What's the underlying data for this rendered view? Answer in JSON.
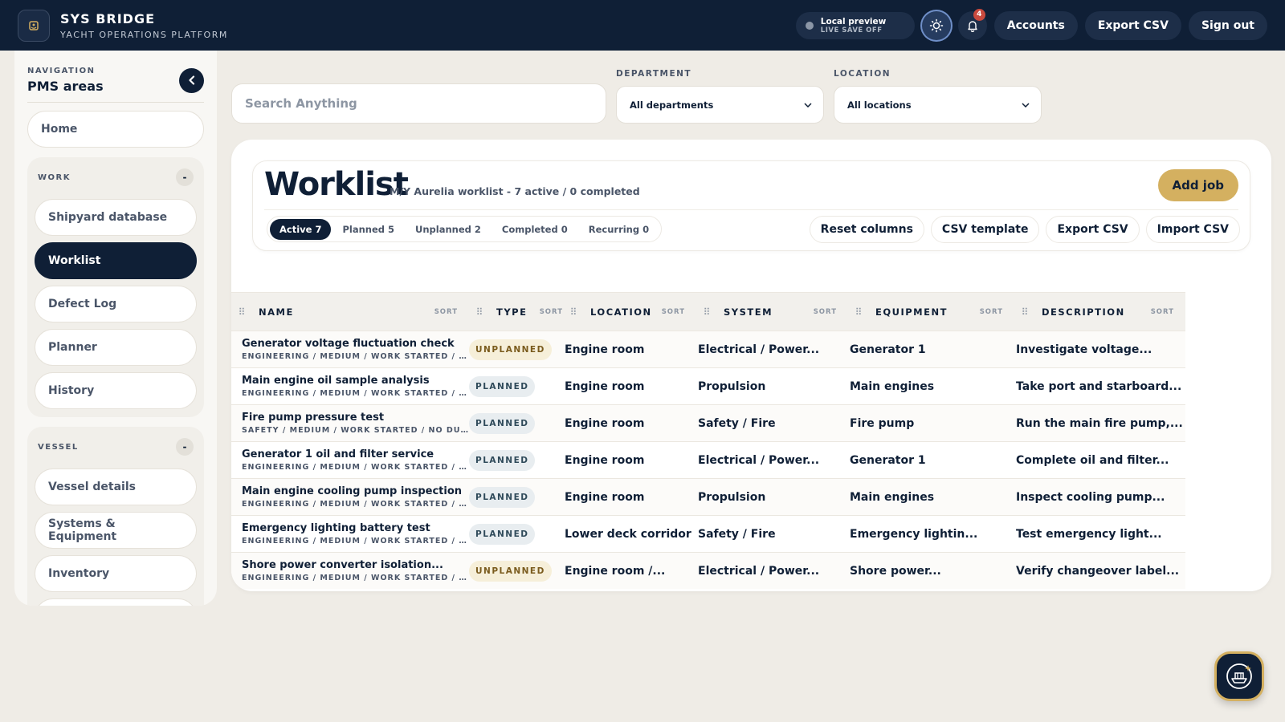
{
  "app": {
    "title": "SYS BRIDGE",
    "subtitle": "YACHT OPERATIONS PLATFORM"
  },
  "topbar": {
    "preview_title": "Local preview",
    "preview_sub": "LIVE SAVE OFF",
    "notifications_count": "4",
    "accounts_label": "Accounts",
    "export_label": "Export CSV",
    "signout_label": "Sign out"
  },
  "sidebar": {
    "kicker": "NAVIGATION",
    "title": "PMS areas",
    "home_label": "Home",
    "groups": [
      {
        "label": "WORK",
        "toggle": "-",
        "items": [
          "Shipyard database",
          "Worklist",
          "Defect Log",
          "Planner",
          "History"
        ]
      },
      {
        "label": "VESSEL",
        "toggle": "-",
        "items": [
          "Vessel details",
          "Systems & Equipment",
          "Inventory"
        ]
      }
    ],
    "active_item": "Worklist"
  },
  "filters": {
    "search_placeholder": "Search Anything",
    "department_label": "DEPARTMENT",
    "department_value": "All departments",
    "location_label": "LOCATION",
    "location_value": "All locations"
  },
  "worklist": {
    "title": "Worklist",
    "subtitle": "M/Y Aurelia worklist - 7 active / 0 completed",
    "add_label": "Add job",
    "tabs": [
      "Active 7",
      "Planned 5",
      "Unplanned 2",
      "Completed 0",
      "Recurring 0"
    ],
    "actions": [
      "Reset columns",
      "CSV template",
      "Export CSV",
      "Import CSV"
    ]
  },
  "table": {
    "sort_label": "SORT",
    "columns": [
      "NAME",
      "TYPE",
      "LOCATION",
      "SYSTEM",
      "EQUIPMENT",
      "DESCRIPTION"
    ],
    "rows": [
      {
        "name": "Generator voltage fluctuation check",
        "meta": "ENGINEERING / MEDIUM / WORK STARTED / ...",
        "type": "UNPLANNED",
        "location": "Engine room",
        "system": "Electrical / Power...",
        "equipment": "Generator 1",
        "description": "Investigate voltage..."
      },
      {
        "name": "Main engine oil sample analysis",
        "meta": "ENGINEERING / MEDIUM / WORK STARTED / ...",
        "type": "PLANNED",
        "location": "Engine room",
        "system": "Propulsion",
        "equipment": "Main engines",
        "description": "Take port and starboard..."
      },
      {
        "name": "Fire pump pressure test",
        "meta": "SAFETY / MEDIUM / WORK STARTED / NO DU...",
        "type": "PLANNED",
        "location": "Engine room",
        "system": "Safety / Fire",
        "equipment": "Fire pump",
        "description": "Run the main fire pump,..."
      },
      {
        "name": "Generator 1 oil and filter service",
        "meta": "ENGINEERING / MEDIUM / WORK STARTED / ...",
        "type": "PLANNED",
        "location": "Engine room",
        "system": "Electrical / Power...",
        "equipment": "Generator 1",
        "description": "Complete oil and filter..."
      },
      {
        "name": "Main engine cooling pump inspection",
        "meta": "ENGINEERING / MEDIUM / WORK STARTED / ...",
        "type": "PLANNED",
        "location": "Engine room",
        "system": "Propulsion",
        "equipment": "Main engines",
        "description": "Inspect cooling pump..."
      },
      {
        "name": "Emergency lighting battery test",
        "meta": "ENGINEERING / MEDIUM / WORK STARTED / ...",
        "type": "PLANNED",
        "location": "Lower deck corridor",
        "system": "Safety / Fire",
        "equipment": "Emergency lightin...",
        "description": "Test emergency light..."
      },
      {
        "name": "Shore power converter isolation...",
        "meta": "ENGINEERING / MEDIUM / WORK STARTED / ...",
        "type": "UNPLANNED",
        "location": "Engine room /...",
        "system": "Electrical / Power...",
        "equipment": "Shore power...",
        "description": "Verify changeover label..."
      }
    ]
  },
  "colors": {
    "navy": "#0f1f36",
    "gold": "#d4b060",
    "page": "#efece6"
  }
}
